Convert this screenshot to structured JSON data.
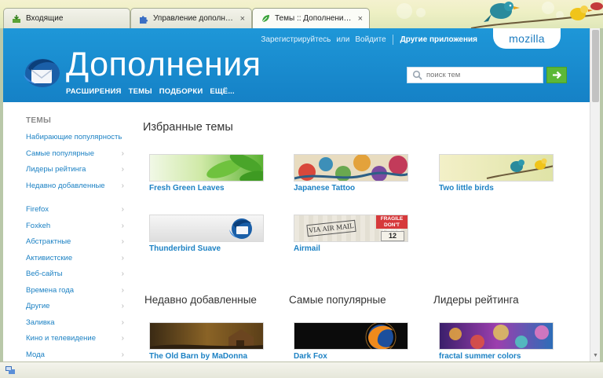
{
  "browser": {
    "tabs": [
      {
        "title": "Входящие",
        "icon": "inbox-icon",
        "active": false
      },
      {
        "title": "Управление дополнения...",
        "icon": "puzzle-icon",
        "active": false
      },
      {
        "title": "Темы :: Дополнения Thu...",
        "icon": "addon-leaf-icon",
        "active": true
      }
    ],
    "close_glyph": "×"
  },
  "header": {
    "topnav": {
      "register": "Зарегистрируйтесь",
      "or": "или",
      "login": "Войдите",
      "other_apps": "Другие приложения"
    },
    "brand": "mozilla",
    "site_title": "Дополнения",
    "nav": [
      "РАСШИРЕНИЯ",
      "ТЕМЫ",
      "ПОДБОРКИ",
      "ЕЩЁ..."
    ],
    "search_placeholder": "поиск тем"
  },
  "sidebar": {
    "heading": "ТЕМЫ",
    "group1": [
      "Набирающие популярность",
      "Самые популярные",
      "Лидеры рейтинга",
      "Недавно добавленные"
    ],
    "group2": [
      "Firefox",
      "Foxkeh",
      "Абстрактные",
      "Активистские",
      "Веб-сайты",
      "Времена года",
      "Другие",
      "Заливка",
      "Кино и телевидение",
      "Мода"
    ],
    "chevron": "›"
  },
  "featured": {
    "title": "Избранные темы",
    "themes": [
      "Fresh Green Leaves",
      "Japanese Tattoo",
      "Two little birds",
      "Thunderbird Suave",
      "Airmail"
    ]
  },
  "airmail_art": {
    "via": "VIA AIR MAIL",
    "fragile": "FRAGILE",
    "dont_crush": "DON'T CRUSH",
    "number": "12"
  },
  "lists": {
    "recent": {
      "title": "Недавно добавленные",
      "first": "The Old Barn by MaDonna"
    },
    "popular": {
      "title": "Самые популярные",
      "first": "Dark Fox"
    },
    "top_rated": {
      "title": "Лидеры рейтинга",
      "first": "fractal summer colors"
    }
  },
  "colors": {
    "header_blue": "#1581c6",
    "link_blue": "#1d82c4",
    "search_button_green": "#5cb837"
  }
}
